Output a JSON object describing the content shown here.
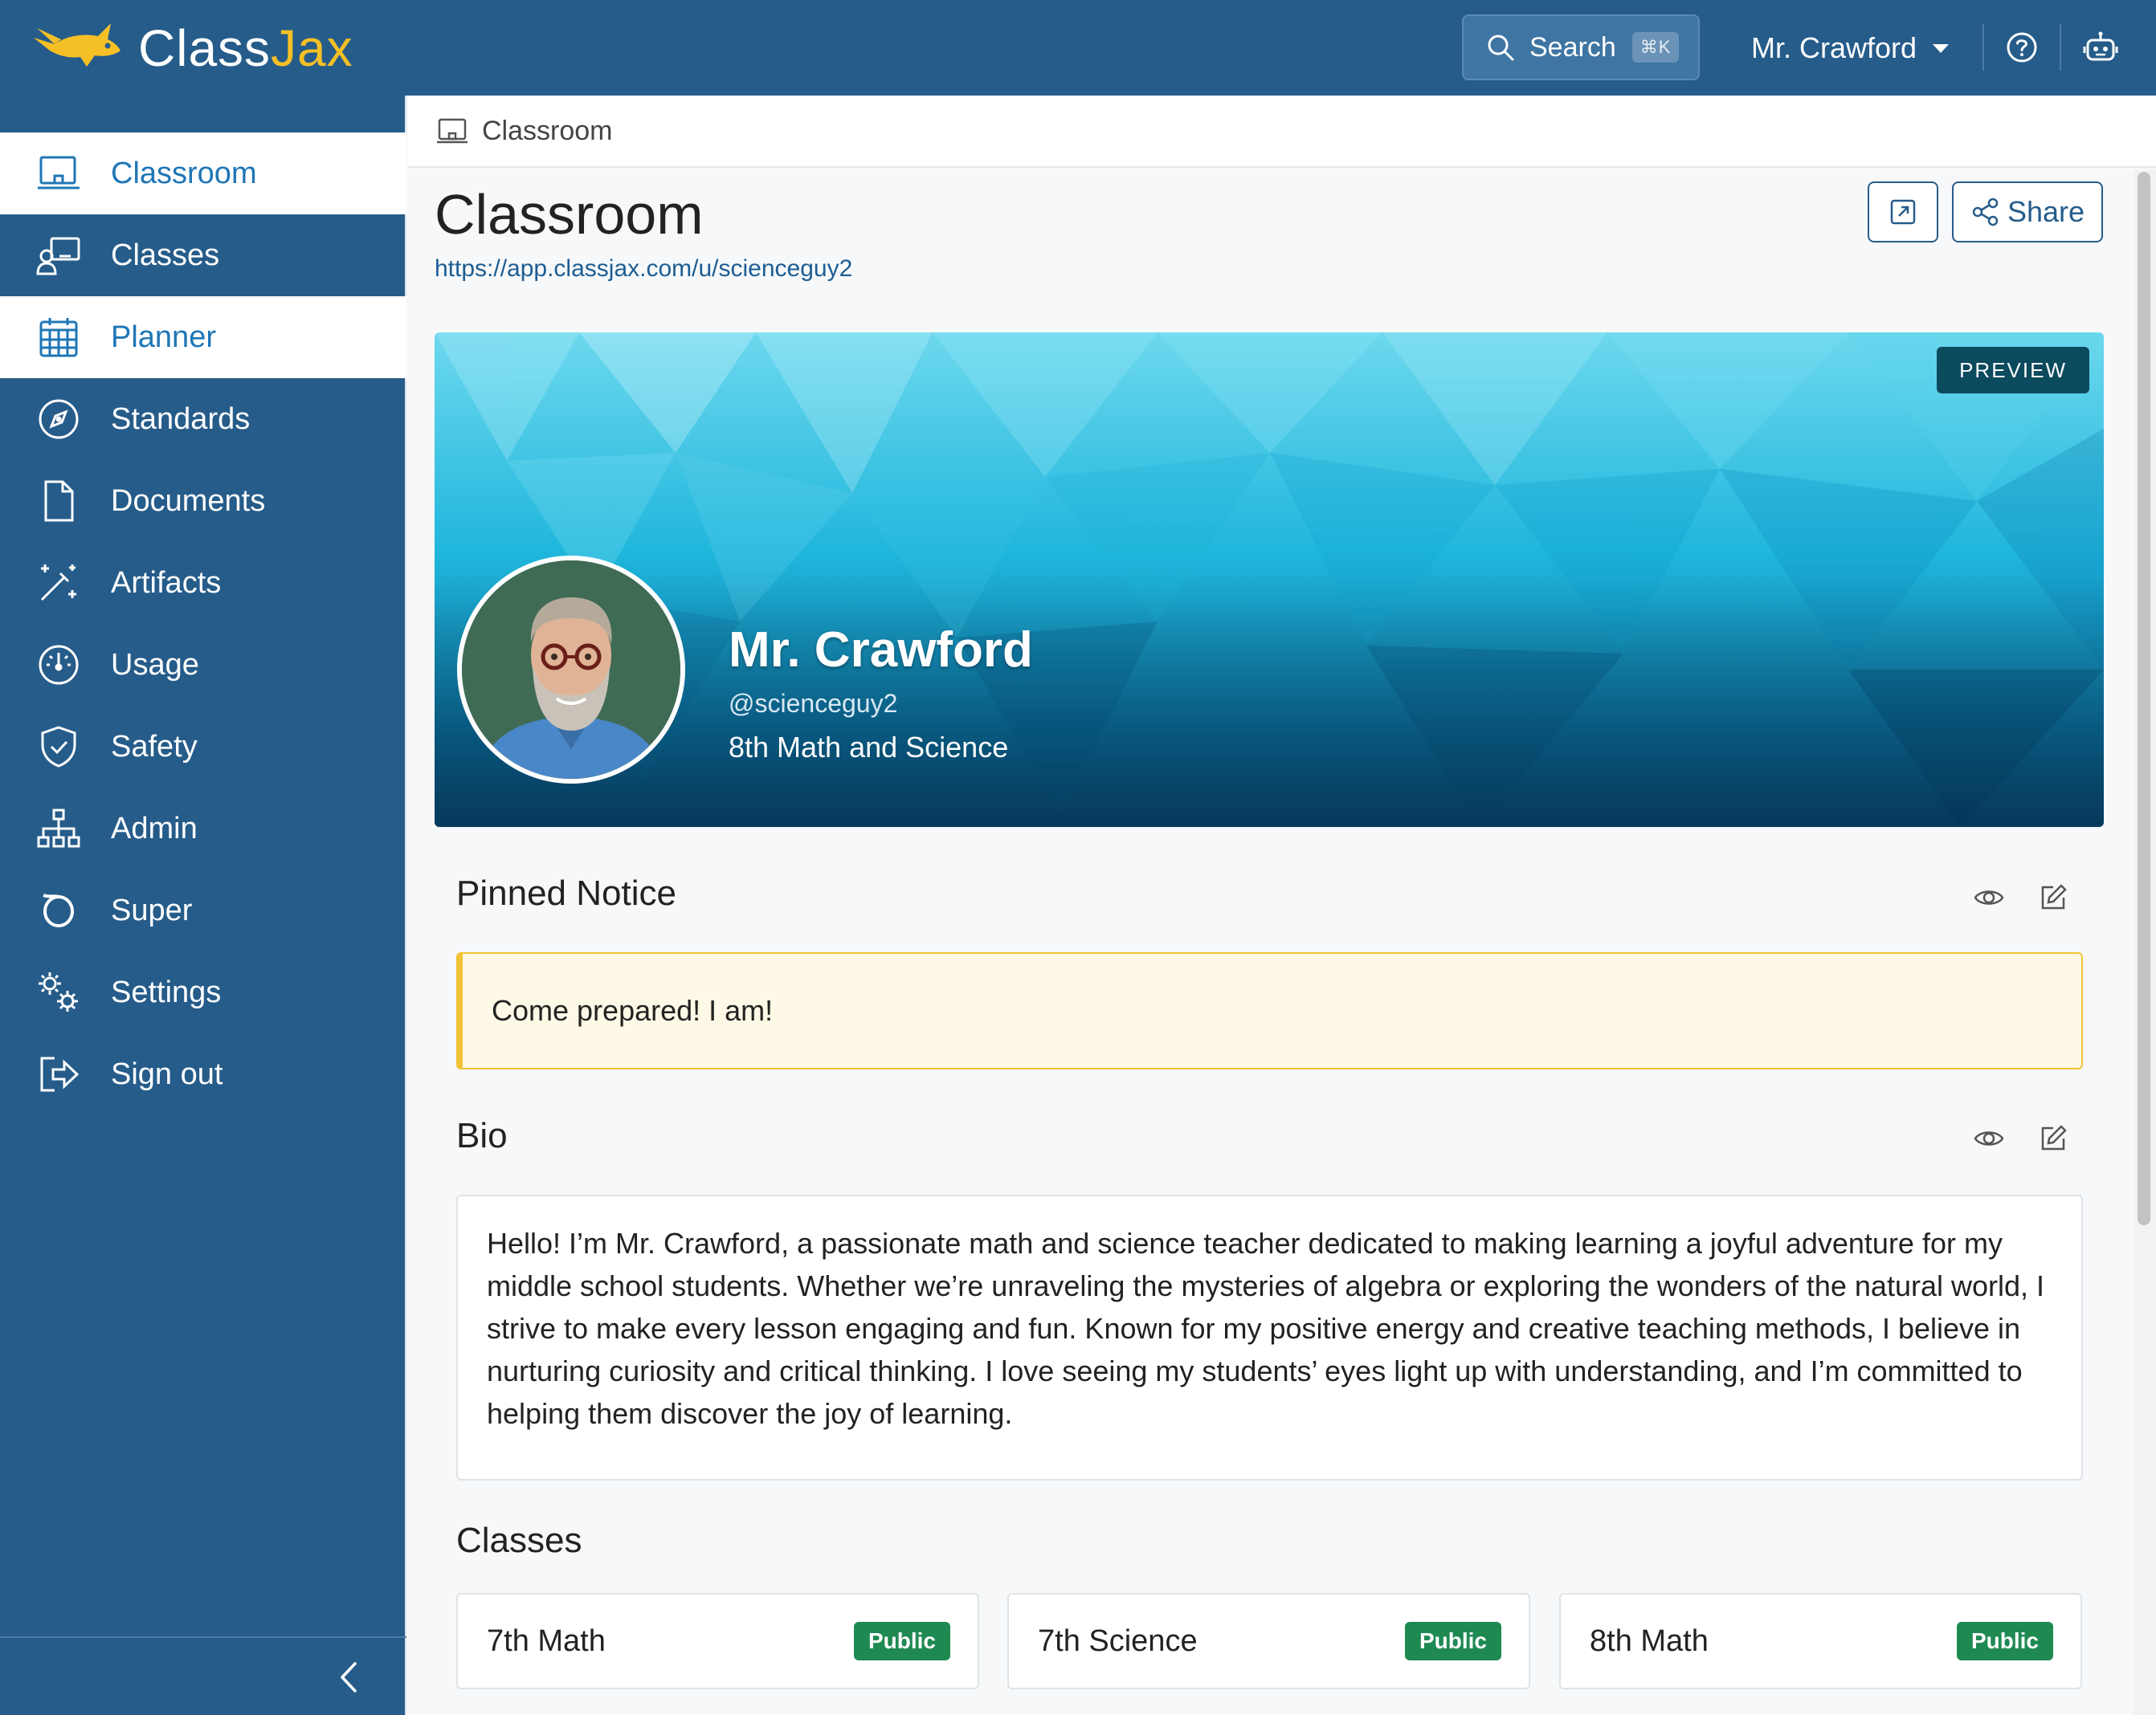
{
  "app": {
    "brand_prefix": "Class",
    "brand_suffix": "Jax",
    "search_label": "Search",
    "search_shortcut": "⌘K",
    "user_menu_label": "Mr. Crawford"
  },
  "sidebar": {
    "items": [
      {
        "label": "Classroom",
        "icon": "monitor-icon",
        "active": true
      },
      {
        "label": "Classes",
        "icon": "teacher-board-icon",
        "active": false
      },
      {
        "label": "Planner",
        "icon": "calendar-icon",
        "active": true
      },
      {
        "label": "Standards",
        "icon": "compass-icon",
        "active": false
      },
      {
        "label": "Documents",
        "icon": "document-icon",
        "active": false
      },
      {
        "label": "Artifacts",
        "icon": "magic-wand-icon",
        "active": false
      },
      {
        "label": "Usage",
        "icon": "speedometer-icon",
        "active": false
      },
      {
        "label": "Safety",
        "icon": "shield-check-icon",
        "active": false
      },
      {
        "label": "Admin",
        "icon": "org-chart-icon",
        "active": false
      },
      {
        "label": "Super",
        "icon": "ring-icon",
        "active": false
      },
      {
        "label": "Settings",
        "icon": "gears-icon",
        "active": false
      },
      {
        "label": "Sign out",
        "icon": "sign-out-icon",
        "active": false
      }
    ]
  },
  "breadcrumb": {
    "label": "Classroom"
  },
  "page": {
    "title": "Classroom",
    "url": "https://app.classjax.com/u/scienceguy2",
    "share_label": "Share"
  },
  "profile": {
    "preview_badge": "PREVIEW",
    "name": "Mr. Crawford",
    "handle": "@scienceguy2",
    "subtitle": "8th Math and Science"
  },
  "pinned_notice": {
    "title": "Pinned Notice",
    "text": "Come prepared! I am!"
  },
  "bio": {
    "title": "Bio",
    "text": "Hello! I’m Mr. Crawford, a passionate math and science teacher dedicated to making learning a joyful adventure for my middle school students. Whether we’re unraveling the mysteries of algebra or exploring the wonders of the natural world, I strive to make every lesson engaging and fun. Known for my positive energy and creative teaching methods, I believe in nurturing curiosity and critical thinking. I love seeing my students’ eyes light up with understanding, and I’m committed to helping them discover the joy of learning."
  },
  "classes": {
    "title": "Classes",
    "items": [
      {
        "name": "7th Math",
        "visibility": "Public"
      },
      {
        "name": "7th Science",
        "visibility": "Public"
      },
      {
        "name": "8th Math",
        "visibility": "Public"
      }
    ]
  },
  "colors": {
    "topbar": "#265c8a",
    "sidebar": "#265c8a",
    "active_text": "#1f76b6",
    "brand_accent": "#f5c025",
    "notice_border": "#f2c335",
    "public_badge": "#1e8a52"
  }
}
